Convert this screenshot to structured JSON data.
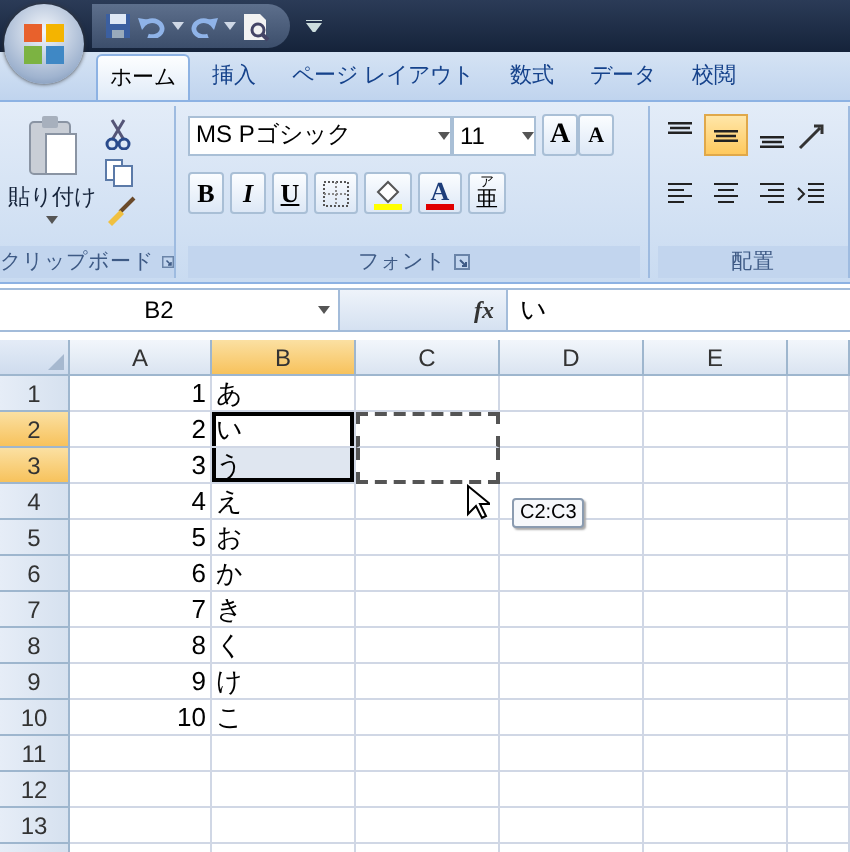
{
  "tabs": [
    {
      "label": "ホーム",
      "selected": true
    },
    {
      "label": "挿入",
      "selected": false
    },
    {
      "label": "ページ レイアウト",
      "selected": false
    },
    {
      "label": "数式",
      "selected": false
    },
    {
      "label": "データ",
      "selected": false
    },
    {
      "label": "校閲",
      "selected": false
    }
  ],
  "ribbon": {
    "clipboard": {
      "paste_label": "貼り付け",
      "label": "クリップボード"
    },
    "font": {
      "font_name": "MS Pゴシック",
      "font_size": "11",
      "grow_label": "A",
      "shrink_label": "A",
      "bold": "B",
      "italic": "I",
      "underline": "U",
      "font_color_label": "A",
      "phonetic_ruby": "ア",
      "phonetic_label": "亜",
      "label": "フォント"
    },
    "alignment": {
      "vertical_buttons": [
        {
          "kind": "top",
          "selected": false
        },
        {
          "kind": "middle",
          "selected": true
        },
        {
          "kind": "bottom",
          "selected": false
        }
      ],
      "label": "配置"
    }
  },
  "formula_bar": {
    "name_box": "B2",
    "fx": "fx",
    "content": "い"
  },
  "sheet": {
    "columns": [
      {
        "label": "A",
        "selected": false
      },
      {
        "label": "B",
        "selected": true
      },
      {
        "label": "C",
        "selected": false
      },
      {
        "label": "D",
        "selected": false
      },
      {
        "label": "E",
        "selected": false
      }
    ],
    "rows": [
      {
        "header": "1",
        "selected": false,
        "marquee": false,
        "cells": [
          {
            "value": "1",
            "selected": false
          },
          {
            "value": "あ",
            "selected": false
          }
        ]
      },
      {
        "header": "2",
        "selected": true,
        "marquee": true,
        "cells": [
          {
            "value": "2",
            "selected": false
          },
          {
            "value": "い",
            "selected": true
          }
        ]
      },
      {
        "header": "3",
        "selected": true,
        "marquee": true,
        "cells": [
          {
            "value": "3",
            "selected": false
          },
          {
            "value": "う",
            "selected": true
          }
        ]
      },
      {
        "header": "4",
        "selected": false,
        "marquee": false,
        "cells": [
          {
            "value": "4",
            "selected": false
          },
          {
            "value": "え",
            "selected": false
          }
        ]
      },
      {
        "header": "5",
        "selected": false,
        "marquee": false,
        "cells": [
          {
            "value": "5",
            "selected": false
          },
          {
            "value": "お",
            "selected": false
          }
        ]
      },
      {
        "header": "6",
        "selected": false,
        "marquee": false,
        "cells": [
          {
            "value": "6",
            "selected": false
          },
          {
            "value": "か",
            "selected": false
          }
        ]
      },
      {
        "header": "7",
        "selected": false,
        "marquee": false,
        "cells": [
          {
            "value": "7",
            "selected": false
          },
          {
            "value": "き",
            "selected": false
          }
        ]
      },
      {
        "header": "8",
        "selected": false,
        "marquee": false,
        "cells": [
          {
            "value": "8",
            "selected": false
          },
          {
            "value": "く",
            "selected": false
          }
        ]
      },
      {
        "header": "9",
        "selected": false,
        "marquee": false,
        "cells": [
          {
            "value": "9",
            "selected": false
          },
          {
            "value": "け",
            "selected": false
          }
        ]
      },
      {
        "header": "10",
        "selected": false,
        "marquee": false,
        "cells": [
          {
            "value": "10",
            "selected": false
          },
          {
            "value": "こ",
            "selected": false
          }
        ]
      },
      {
        "header": "11",
        "selected": false,
        "marquee": false
      },
      {
        "header": "12",
        "selected": false,
        "marquee": false
      },
      {
        "header": "13",
        "selected": false,
        "marquee": false
      }
    ],
    "drag_tooltip": "C2:C3"
  }
}
